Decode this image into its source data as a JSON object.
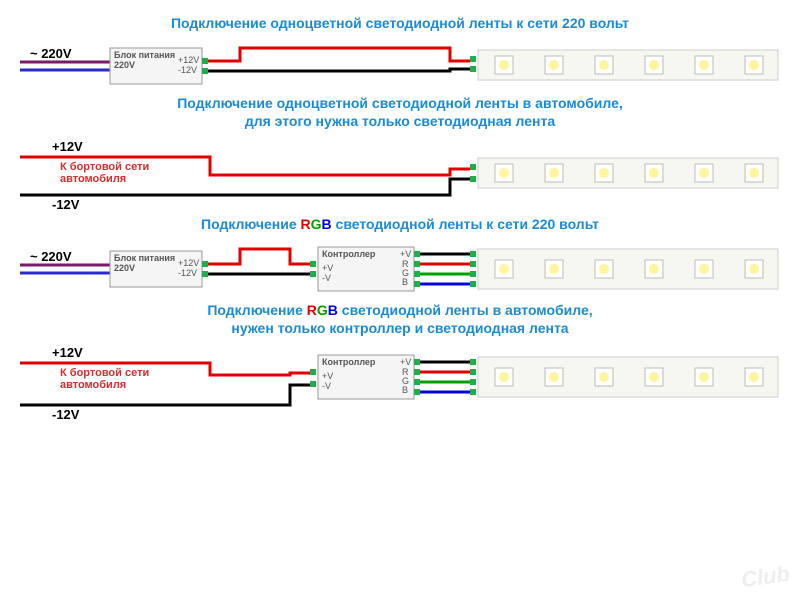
{
  "title1": "Подключение одноцветной светодиодной ленты к сети 220 вольт",
  "title2_l1": "Подключение одноцветной светодиодной ленты в автомобиле,",
  "title2_l2": "для этого нужна только светодиодная лента",
  "title3_pre": "Подключение ",
  "title3_post": " светодиодной ленты к сети 220 вольт",
  "title4_pre_l1": "Подключение ",
  "title4_post_l1": " светодиодной ленты в автомобиле,",
  "title4_l2": "нужен только контроллер и светодиодная лента",
  "ac220": "~ 220V",
  "psu": {
    "name": "Блок питания",
    "in": "220V",
    "outp": "+12V",
    "outn": "-12V"
  },
  "ctrl": {
    "name": "Контроллер",
    "inp": "+V",
    "inn": "-V",
    "v": "+V",
    "r": "R",
    "g": "G",
    "b": "B"
  },
  "p12": "+12V",
  "n12": "-12V",
  "car": "К бортовой сети\nавтомобиля",
  "wm": "Club"
}
